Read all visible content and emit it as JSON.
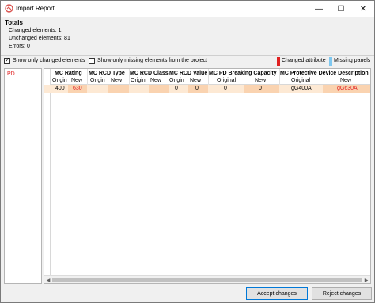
{
  "window": {
    "title": "Import Report"
  },
  "titlebar_buttons": {
    "minimize": "—",
    "maximize": "☐",
    "close": "✕"
  },
  "totals": {
    "heading": "Totals",
    "changed": "Changed elements: 1",
    "unchanged": "Unchanged elements: 81",
    "errors": "Errors: 0"
  },
  "options": {
    "show_changed": {
      "label": "Show only changed elements",
      "checked": true
    },
    "show_missing": {
      "label": "Show only missing elements from the project",
      "checked": false
    }
  },
  "legend": {
    "changed": {
      "label": "Changed attribute",
      "color": "#e02020"
    },
    "missing": {
      "label": "Missing panels",
      "color": "#7fc8f0"
    }
  },
  "panels": [
    "PD"
  ],
  "table": {
    "columns": [
      {
        "name": "MC Rating",
        "sub": [
          "Origin",
          "New"
        ]
      },
      {
        "name": "MC RCD Type",
        "sub": [
          "Origin",
          "New"
        ]
      },
      {
        "name": "MC RCD Class",
        "sub": [
          "Origin",
          "New"
        ]
      },
      {
        "name": "MC RCD Value",
        "sub": [
          "Origin",
          "New"
        ]
      },
      {
        "name": "MC PD Breaking Capacity",
        "sub": [
          "Original",
          "New"
        ]
      },
      {
        "name": "MC Protective Device Description",
        "sub": [
          "Original",
          "New"
        ]
      }
    ],
    "row": {
      "rating_orig": "400",
      "rating_new": "630",
      "rcd_value_orig": "0",
      "rcd_value_new": "0",
      "breaking_orig": "0",
      "breaking_new": "0",
      "desc_orig": "gG400A",
      "desc_new": "gG630A"
    }
  },
  "buttons": {
    "accept": "Accept changes",
    "reject": "Reject changes"
  }
}
